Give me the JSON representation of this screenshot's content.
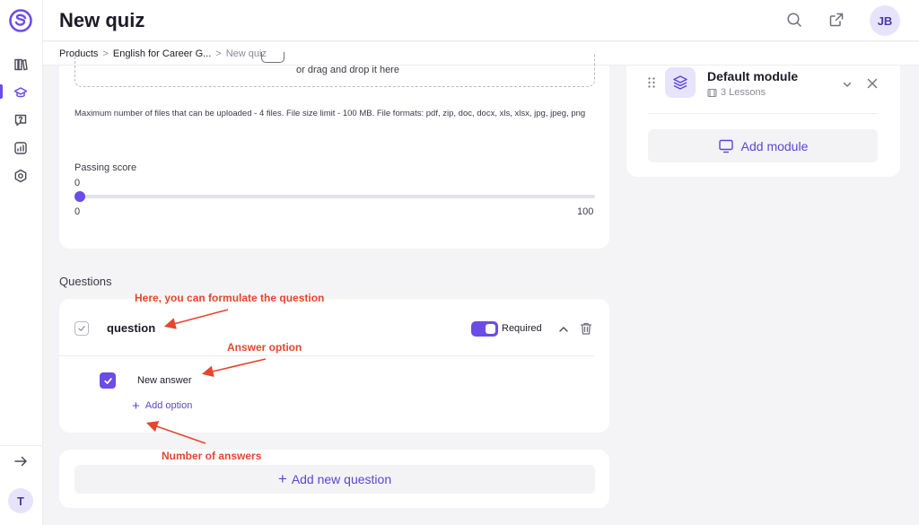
{
  "header": {
    "title": "New quiz",
    "avatar_initials": "JB"
  },
  "sidebar": {
    "items": [
      {
        "name": "library",
        "icon": "library-icon"
      },
      {
        "name": "courses",
        "icon": "graduation-cap-icon",
        "active": true
      },
      {
        "name": "help",
        "icon": "question-bubble-icon"
      },
      {
        "name": "analytics",
        "icon": "chart-icon"
      },
      {
        "name": "settings",
        "icon": "hexagon-gear-icon"
      }
    ],
    "user_initial": "T",
    "accent": "#6b4ce6"
  },
  "breadcrumb": {
    "items": [
      "Products",
      "English for Career G...",
      "New quiz"
    ],
    "separator": ">"
  },
  "upload": {
    "drop_text": "or drag and drop it here",
    "note": "Maximum number of files that can be uploaded - 4 files. File size limit - 100 MB. File formats: pdf, zip, doc, docx, xls, xlsx, jpg, jpeg, png"
  },
  "passing_score": {
    "label": "Passing score",
    "value": "0",
    "min": "0",
    "max": "100",
    "level": 0
  },
  "questions": {
    "section_title": "Questions",
    "question": {
      "text": "question",
      "required_label": "Required",
      "required": true,
      "answers": [
        {
          "text": "New answer",
          "checked": true
        }
      ],
      "add_option_label": "Add option"
    },
    "add_question_label": "Add new question"
  },
  "module": {
    "title": "Default module",
    "lessons_label": "3 Lessons",
    "add_module_label": "Add module"
  },
  "annotations": {
    "question_note": "Here, you can formulate the question",
    "answer_note": "Answer option",
    "count_note": "Number of answers"
  }
}
